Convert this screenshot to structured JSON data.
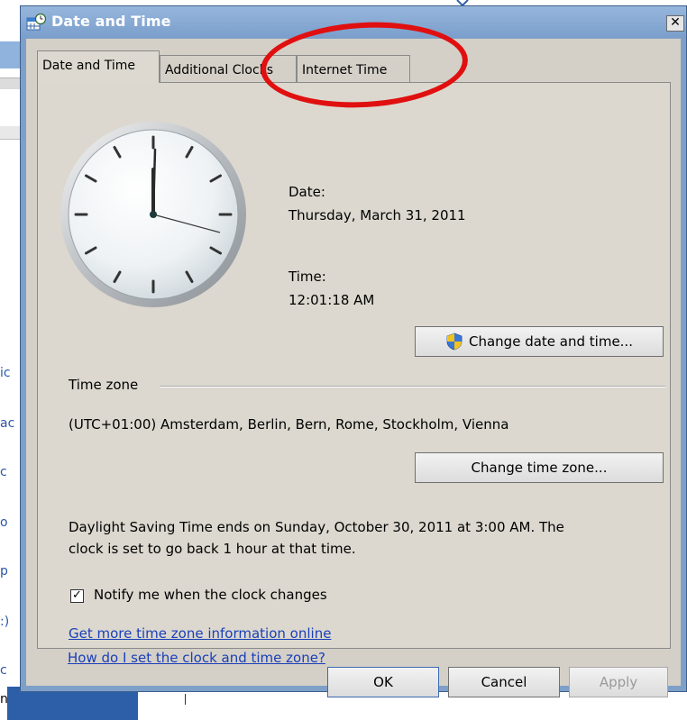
{
  "window": {
    "title": "Date and Time",
    "close_glyph": "✕"
  },
  "tabs": [
    {
      "label": "Date and Time",
      "active": true
    },
    {
      "label": "Additional Clocks",
      "active": false
    },
    {
      "label": "Internet Time",
      "active": false
    }
  ],
  "datetime": {
    "date_label": "Date:",
    "date_value": "Thursday, March 31, 2011",
    "time_label": "Time:",
    "time_value": "12:01:18 AM",
    "change_button": "Change date and time..."
  },
  "timezone": {
    "group_label": "Time zone",
    "value": "(UTC+01:00) Amsterdam, Berlin, Bern, Rome, Stockholm, Vienna",
    "change_button": "Change time zone..."
  },
  "dst": {
    "line1": "Daylight Saving Time ends on Sunday, October 30, 2011 at 3:00 AM. The",
    "line2": "clock is set to go back 1 hour at that time."
  },
  "notify": {
    "label": "Notify me when the clock changes",
    "checked": true,
    "check_glyph": "✓"
  },
  "links": {
    "more_info": "Get more time zone information online",
    "how_to": "How do I set the clock and time zone?"
  },
  "footer": {
    "ok": "OK",
    "cancel": "Cancel",
    "apply": "Apply"
  },
  "background_fragments": [
    "ic",
    "ac",
    "c",
    "o",
    "p",
    ":)",
    "c",
    "n"
  ],
  "icons": [
    "calendar-clock-icon",
    "shield-uac-icon",
    "analog-clock-icon"
  ],
  "colors": {
    "titlebar": "#7b9fcc",
    "client": "#d4d0c8",
    "link": "#1a3fb8",
    "annotation": "#e01010"
  }
}
